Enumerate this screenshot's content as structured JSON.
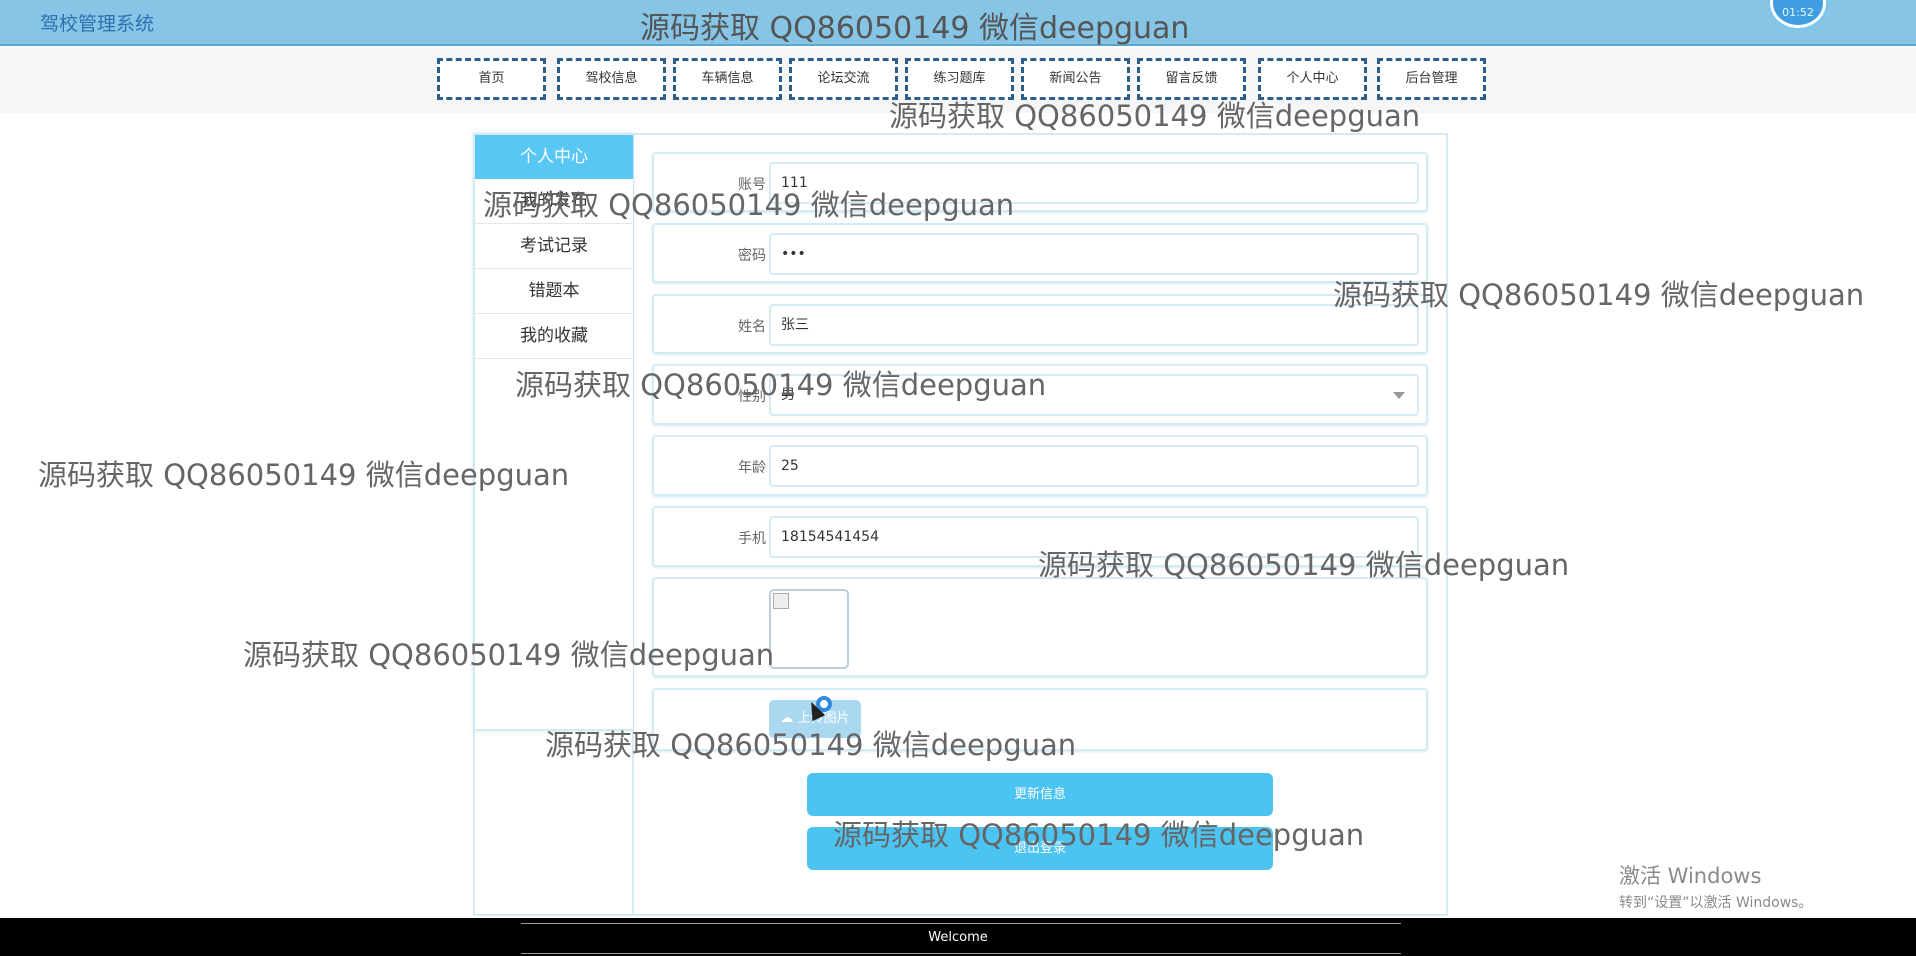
{
  "header": {
    "site_title": "驾校管理系统",
    "clock": "01:52"
  },
  "nav": {
    "items": [
      "首页",
      "驾校信息",
      "车辆信息",
      "论坛交流",
      "练习题库",
      "新闻公告",
      "留言反馈",
      "个人中心",
      "后台管理"
    ]
  },
  "sidebar": {
    "title": "个人中心",
    "items": [
      "我的发布",
      "考试记录",
      "错题本",
      "我的收藏"
    ]
  },
  "form": {
    "account": {
      "label": "账号",
      "value": "111"
    },
    "password": {
      "label": "密码",
      "value": "•••"
    },
    "name": {
      "label": "姓名",
      "value": "张三"
    },
    "gender": {
      "label": "性别",
      "value": "男"
    },
    "age": {
      "label": "年龄",
      "value": "25"
    },
    "phone": {
      "label": "手机",
      "value": "18154541454"
    },
    "upload_label": "上传图片"
  },
  "buttons": {
    "update": "更新信息",
    "logout": "退出登录"
  },
  "footer": {
    "text": "Welcome"
  },
  "watermark": "源码获取 QQ86050149 微信deepguan",
  "os_notice": {
    "title": "激活 Windows",
    "subtitle": "转到“设置”以激活 Windows。"
  }
}
